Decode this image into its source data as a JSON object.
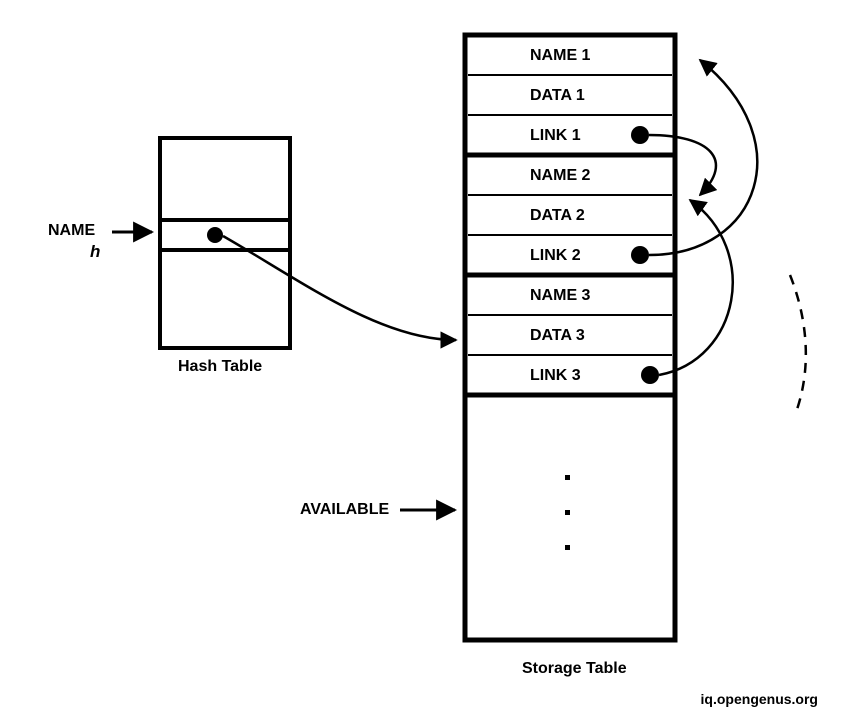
{
  "labels": {
    "name_input": "NAME",
    "h": "h",
    "hash_table_caption": "Hash Table",
    "available": "AVAILABLE",
    "storage_table_caption": "Storage Table",
    "attribution": "iq.opengenus.org"
  },
  "storage": {
    "row1": {
      "name": "NAME 1",
      "data": "DATA 1",
      "link": "LINK 1"
    },
    "row2": {
      "name": "NAME 2",
      "data": "DATA 2",
      "link": "LINK 2"
    },
    "row3": {
      "name": "NAME 3",
      "data": "DATA 3",
      "link": "LINK 3"
    }
  }
}
